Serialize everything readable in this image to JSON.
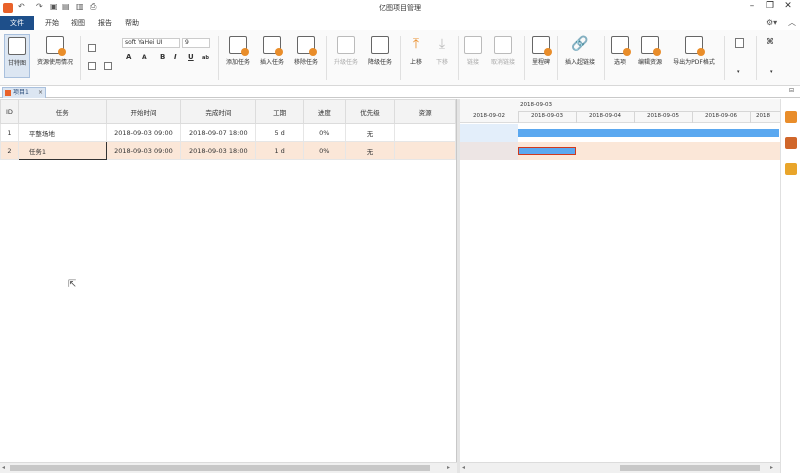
{
  "titlebar": {
    "title": "亿图项目管理",
    "quick_access": [
      "undo-icon",
      "redo-icon",
      "save-icon",
      "print-icon"
    ],
    "window_buttons": [
      "minimize",
      "restore",
      "close"
    ]
  },
  "menubar": {
    "file": "文件",
    "items": [
      "开始",
      "视图",
      "报告",
      "帮助"
    ],
    "right": [
      "settings-icon",
      "collapse-ribbon-icon"
    ]
  },
  "ribbon": {
    "gantt_view": "甘特图",
    "resource_usage": "资源使用情况",
    "font_name": "soft YaHei UI",
    "font_size": "9",
    "format_buttons": [
      "A",
      "A",
      "B",
      "I",
      "U",
      "ab"
    ],
    "add_task": "添加任务",
    "insert_task": "插入任务",
    "remove_task": "移除任务",
    "upgrade_task": "升级任务",
    "downgrade_task": "降级任务",
    "move_up": "上移",
    "move_down": "下移",
    "link": "链接",
    "unlink": "取消链接",
    "milestone": "里程碑",
    "insert_hyperlink": "插入超链接",
    "options": "选项",
    "edit_resources": "编辑资源",
    "export_pdf": "导出为PDF格式"
  },
  "doc_tab": {
    "label": "项目1",
    "close": "×"
  },
  "grid": {
    "columns": [
      "ID",
      "任务",
      "开始时间",
      "完成时间",
      "工期",
      "进度",
      "优先级",
      "资源"
    ],
    "rows": [
      {
        "id": "1",
        "task": "平整场地",
        "start": "2018-09-03 09:00",
        "finish": "2018-09-07 18:00",
        "duration": "5 d",
        "progress": "0%",
        "priority": "无",
        "resource": ""
      },
      {
        "id": "2",
        "task": "任务1",
        "start": "2018-09-03 09:00",
        "finish": "2018-09-03 18:00",
        "duration": "1 d",
        "progress": "0%",
        "priority": "无",
        "resource": ""
      }
    ]
  },
  "gantt": {
    "week_label": "2018-09-03",
    "days": [
      "2018-09-02",
      "2018-09-03",
      "2018-09-04",
      "2018-09-05",
      "2018-09-06",
      "2018"
    ],
    "bars": [
      {
        "row": 1,
        "start_day": 1,
        "length_days": 5,
        "color": "#5aa8f0"
      },
      {
        "row": 2,
        "start_day": 1,
        "length_days": 1,
        "color": "#5aa8f0"
      }
    ]
  },
  "colors": {
    "accent": "#1e4f8a",
    "selected_row": "#fbe7d8",
    "bar": "#5aa8f0",
    "today_column": "#e3eefa"
  }
}
